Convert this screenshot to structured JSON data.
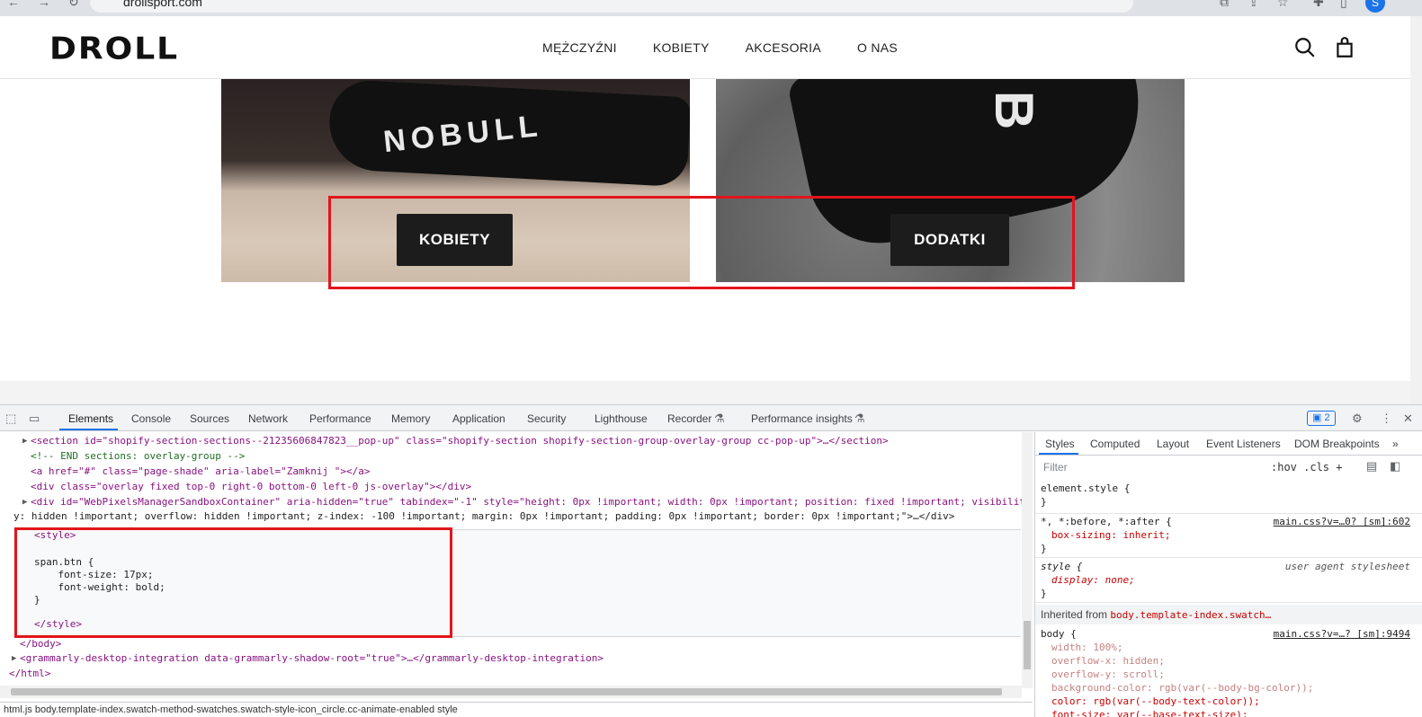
{
  "browser": {
    "url": "drollsport.com",
    "profile_initial": "S"
  },
  "site": {
    "logo": "DROLL",
    "nav": [
      "MĘŻCZYŹNI",
      "KOBIETY",
      "AKCESORIA",
      "O NAS"
    ],
    "icons": [
      "search-icon",
      "bag-icon"
    ]
  },
  "hero": {
    "left_sock_text": "NOBULL",
    "right_sock_text": "B",
    "buttons": [
      "KOBIETY",
      "DODATKI"
    ],
    "highlight_color": "#e3141b"
  },
  "devtools": {
    "tabs": [
      "Elements",
      "Console",
      "Sources",
      "Network",
      "Performance",
      "Memory",
      "Application",
      "Security",
      "Lighthouse",
      "Recorder",
      "Performance insights"
    ],
    "active_tab": "Elements",
    "issues_badge": "2",
    "dom_lines": [
      {
        "text": "<section id=\"shopify-section-sections--21235606847823__pop-up\" class=\"shopify-section shopify-section-group-overlay-group cc-pop-up\">…</section>"
      },
      {
        "text": "<!-- END sections: overlay-group -->"
      },
      {
        "text": "<a href=\"#\" class=\"page-shade\" aria-label=\"Zamknij \"></a>"
      },
      {
        "text": "<div class=\"overlay fixed top-0 right-0 bottom-0 left-0 js-overlay\"></div>"
      },
      {
        "text": "<div id=\"WebPixelsManagerSandboxContainer\" aria-hidden=\"true\" tabindex=\"-1\" style=\"height: 0px !important; width: 0px !important; position: fixed !important; visibilit"
      },
      {
        "text": "y: hidden !important; overflow: hidden !important; z-index: -100 !important; margin: 0px !important; padding: 0px !important; border: 0px !important;\">…</div>"
      },
      {
        "text": "<style>"
      },
      {
        "text": ""
      },
      {
        "text": "span.btn {"
      },
      {
        "text": "    font-size: 17px;"
      },
      {
        "text": "    font-weight: bold;"
      },
      {
        "text": "}"
      },
      {
        "text": ""
      },
      {
        "text": "</style>"
      },
      {
        "text": "</body>"
      },
      {
        "text": "<grammarly-desktop-integration data-grammarly-shadow-root=\"true\">…</grammarly-desktop-integration>"
      },
      {
        "text": "</html>"
      }
    ],
    "breadcrumb": "html.js   body.template-index.swatch-method-swatches.swatch-style-icon_circle.cc-animate-enabled   style",
    "styles_tabs": [
      "Styles",
      "Computed",
      "Layout",
      "Event Listeners",
      "DOM Breakpoints",
      "»"
    ],
    "filter_placeholder": "Filter",
    "filter_tools": ":hov  .cls  +",
    "rules": {
      "element_style": {
        "selector": "element.style {",
        "close": "}"
      },
      "universal": {
        "selector": "*, *:before, *:after {",
        "source": "main.css?v=…0? [sm]:602",
        "decl": "box-sizing: inherit;",
        "close": "}"
      },
      "ua": {
        "selector": "style {",
        "source": "user agent stylesheet",
        "decl": "display: none;",
        "close": "}"
      },
      "inherited_label": "Inherited from",
      "inherited_selector": "body.template-index.swatch…",
      "body": {
        "selector": "body {",
        "source": "main.css?v=…? [sm]:9494",
        "decls": [
          "width: 100%;",
          "overflow-x: hidden;",
          "overflow-y: scroll;",
          "background-color: rgb(var(--body-bg-color));",
          "color: rgb(var(--body-text-color));",
          "font-size: var(--base-text-size);"
        ]
      }
    }
  }
}
